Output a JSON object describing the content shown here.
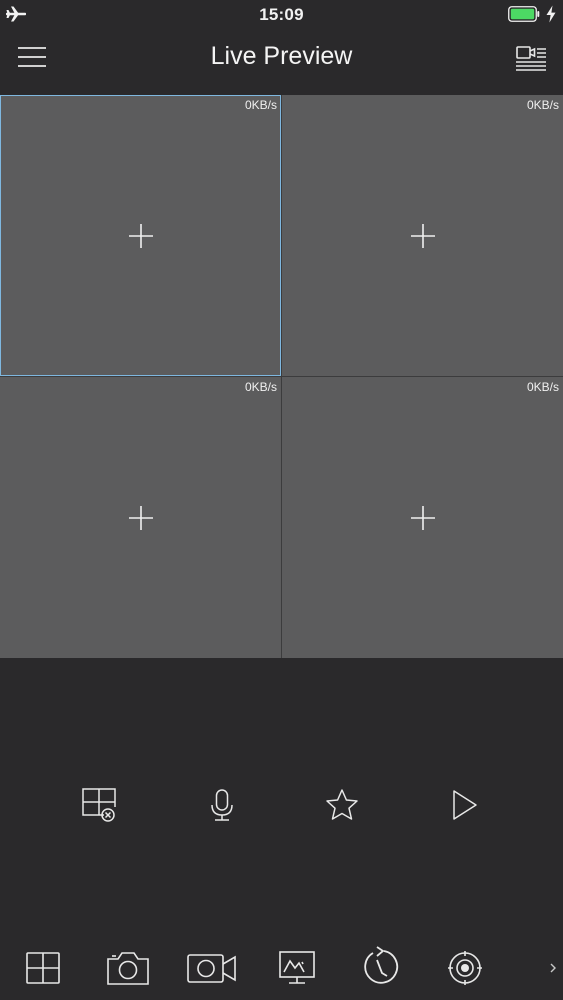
{
  "status_bar": {
    "time": "15:09",
    "airplane_icon": "airplane-icon",
    "battery_icon": "battery-icon",
    "charging_icon": "charging-bolt-icon",
    "battery_color": "#4cd964"
  },
  "nav": {
    "title": "Live Preview",
    "menu_icon": "hamburger-menu-icon",
    "device_icon": "device-list-icon"
  },
  "preview": {
    "selected_border_color": "#7fb8e0",
    "cells": [
      {
        "rate": "0KB/s",
        "add_icon": "plus-icon",
        "selected": true
      },
      {
        "rate": "0KB/s",
        "add_icon": "plus-icon",
        "selected": false
      },
      {
        "rate": "0KB/s",
        "add_icon": "plus-icon",
        "selected": false
      },
      {
        "rate": "0KB/s",
        "add_icon": "plus-icon",
        "selected": false
      }
    ]
  },
  "controls": {
    "row1": [
      "close-all-windows-icon",
      "microphone-icon",
      "star-icon",
      "play-icon"
    ],
    "row2": [
      "split-layout-icon",
      "camera-snapshot-icon",
      "video-record-icon",
      "monitor-chart-icon",
      "playback-history-icon",
      "ptz-target-icon"
    ],
    "more_icon": "chevron-right-icon"
  },
  "colors": {
    "background": "#2a292b",
    "cell_fill": "#5c5c5d"
  }
}
